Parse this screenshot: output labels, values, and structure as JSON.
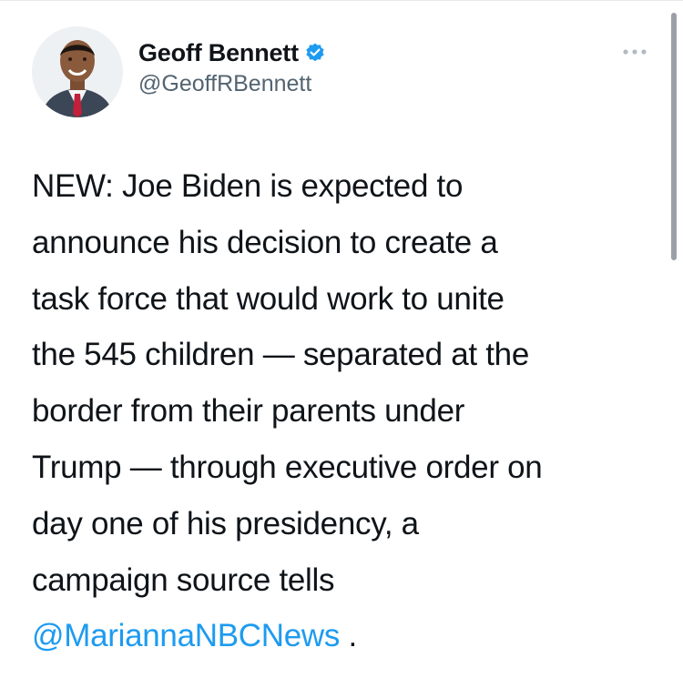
{
  "tweet": {
    "author": {
      "display_name": "Geoff Bennett",
      "handle": "@GeoffRBennett",
      "verified": true,
      "avatar_icon": "profile-photo"
    },
    "more_icon": "ellipsis-icon",
    "body_lines": [
      "NEW: Joe Biden is expected to",
      "announce his decision to create a",
      "task force that would work to unite",
      "the 545 children — separated at the",
      "border from their parents under",
      "Trump — through executive order on",
      "day one of his presidency, a",
      "campaign source tells"
    ],
    "mention": "@MariannaNBCNews",
    "trailing": " ."
  },
  "colors": {
    "text": "#0f1419",
    "secondary_text": "#536471",
    "accent": "#1d9bf0",
    "background": "#ffffff"
  }
}
